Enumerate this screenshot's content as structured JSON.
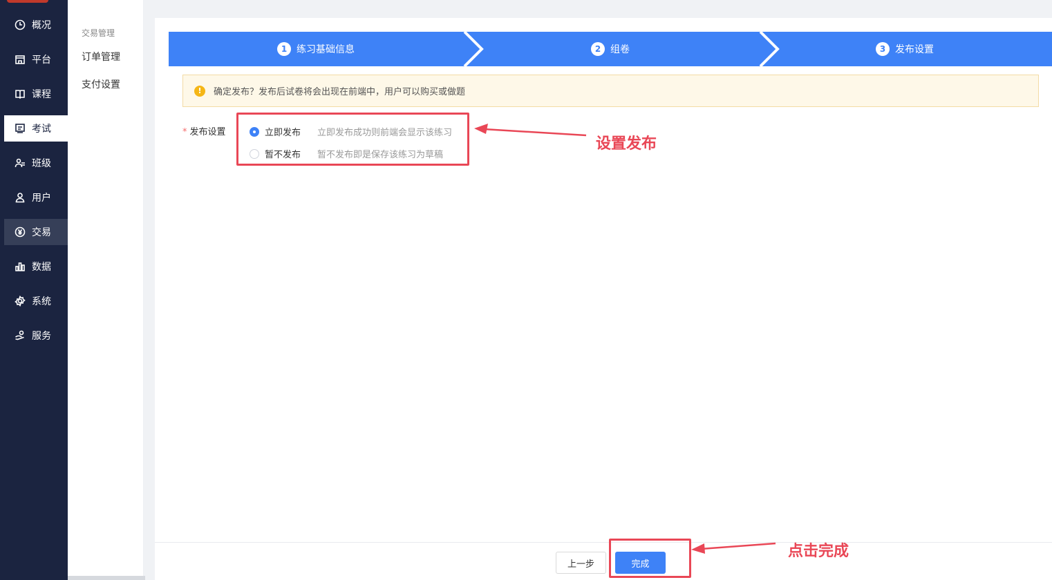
{
  "nav": {
    "items": [
      {
        "label": "概况",
        "icon": "clock-icon"
      },
      {
        "label": "平台",
        "icon": "store-icon"
      },
      {
        "label": "课程",
        "icon": "book-icon"
      },
      {
        "label": "考试",
        "icon": "exam-icon"
      },
      {
        "label": "班级",
        "icon": "class-icon"
      },
      {
        "label": "用户",
        "icon": "user-icon"
      },
      {
        "label": "交易",
        "icon": "yen-icon"
      },
      {
        "label": "数据",
        "icon": "bar-chart-icon"
      },
      {
        "label": "系统",
        "icon": "gear-icon"
      },
      {
        "label": "服务",
        "icon": "service-icon"
      }
    ],
    "active": "考试",
    "hovered": "交易"
  },
  "submenu": {
    "group_title": "交易管理",
    "items": [
      "订单管理",
      "支付设置"
    ]
  },
  "steps": [
    {
      "num": "1",
      "label": "练习基础信息"
    },
    {
      "num": "2",
      "label": "组卷"
    },
    {
      "num": "3",
      "label": "发布设置"
    }
  ],
  "alert": {
    "icon": "!",
    "text": "确定发布？发布后试卷将会出现在前端中，用户可以购买或做题"
  },
  "form": {
    "label": "发布设置",
    "required_mark": "*",
    "options": [
      {
        "label": "立即发布",
        "desc": "立即发布成功则前端会显示该练习",
        "checked": true
      },
      {
        "label": "暂不发布",
        "desc": "暂不发布即是保存该练习为草稿",
        "checked": false
      }
    ]
  },
  "footer": {
    "prev_label": "上一步",
    "done_label": "完成"
  },
  "annotations": {
    "publish_note": "设置发布",
    "finish_note": "点击完成",
    "color": "#e94756"
  },
  "colors": {
    "primary": "#3e82f7",
    "nav_bg": "#1b2440"
  }
}
